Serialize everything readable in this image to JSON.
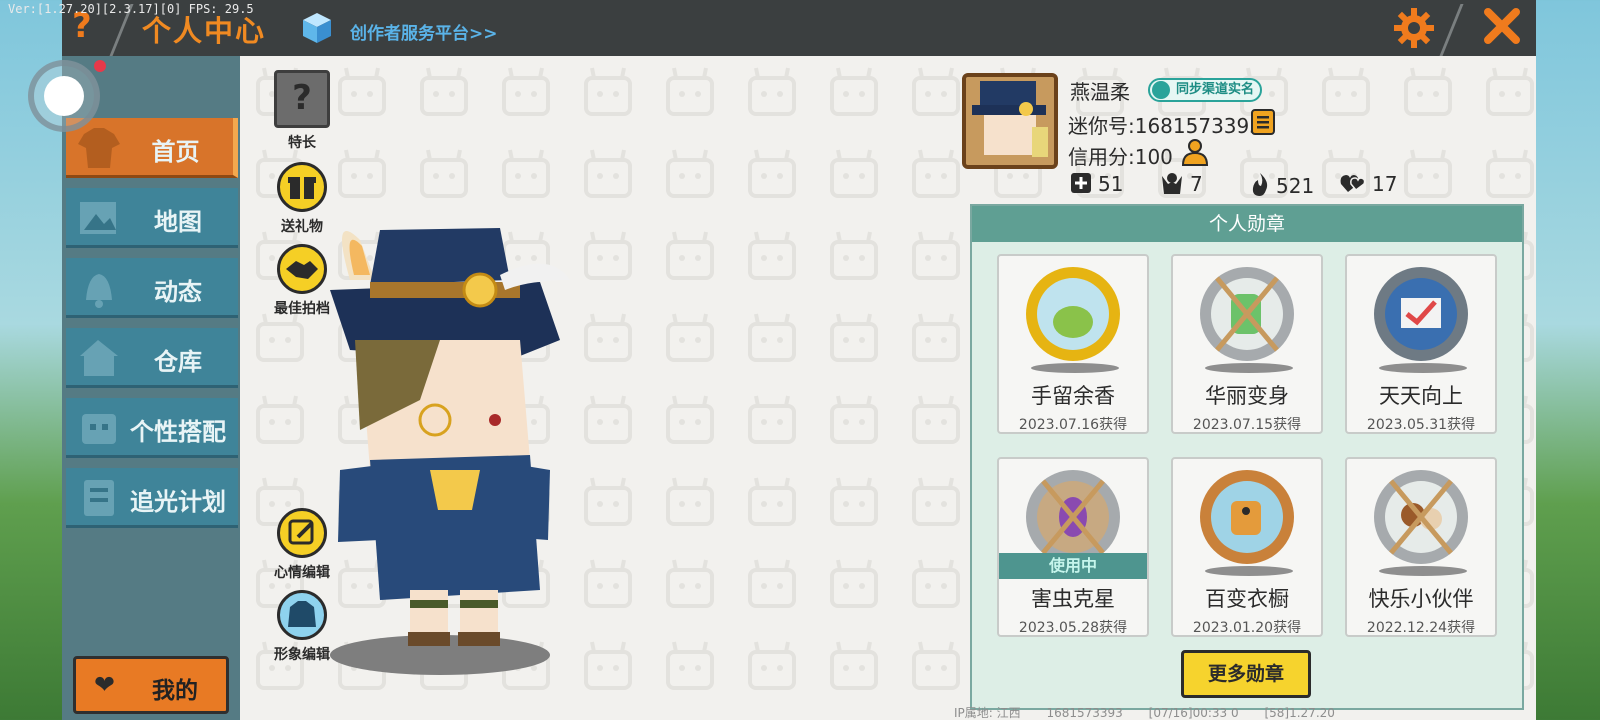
{
  "debug_text": "Ver:[1.27.20][2.3.17][0] FPS: 29.5",
  "header": {
    "help_glyph": "?",
    "title": "个人中心",
    "creator_link": "创作者服务平台>>",
    "settings_icon": "gear-icon",
    "close_icon": "close-icon",
    "accent_color": "#f07b1d"
  },
  "sidebar": {
    "items": [
      {
        "label": "首页",
        "icon": "shirt-icon",
        "active": true
      },
      {
        "label": "地图",
        "icon": "map-icon",
        "active": false
      },
      {
        "label": "动态",
        "icon": "bell-icon",
        "active": false
      },
      {
        "label": "仓库",
        "icon": "house-icon",
        "active": false
      },
      {
        "label": "个性搭配",
        "icon": "outfit-icon",
        "active": false
      },
      {
        "label": "追光计划",
        "icon": "plan-icon",
        "active": false
      }
    ],
    "mine_label": "我的",
    "active_color": "#d8742a"
  },
  "left_actions": {
    "specialty": "特长",
    "gift": "送礼物",
    "best_photo": "最佳拍档",
    "mood_edit": "心情编辑",
    "avatar_edit": "形象编辑"
  },
  "profile": {
    "name": "燕温柔",
    "sync_badge": "同步渠道实名",
    "mini_id": "迷你号:1681573393",
    "credit": "信用分:100",
    "stats": [
      {
        "icon": "add-friend-icon",
        "value": "51"
      },
      {
        "icon": "fans-icon",
        "value": "7"
      },
      {
        "icon": "flame-icon",
        "value": "521"
      },
      {
        "icon": "hearts-icon",
        "value": "17"
      }
    ]
  },
  "medals": {
    "title": "个人勋章",
    "in_use_label": "使用中",
    "items": [
      {
        "name": "手留余香",
        "date": "2023.07.16获得",
        "color": "#e6b412",
        "in_use": false
      },
      {
        "name": "华丽变身",
        "date": "2023.07.15获得",
        "color": "#a6aaad",
        "in_use": false
      },
      {
        "name": "天天向上",
        "date": "2023.05.31获得",
        "color": "#6e7a84",
        "in_use": false
      },
      {
        "name": "害虫克星",
        "date": "2023.05.28获得",
        "color": "#a6aaad",
        "in_use": true
      },
      {
        "name": "百变衣橱",
        "date": "2023.01.20获得",
        "color": "#c9813a",
        "in_use": false
      },
      {
        "name": "快乐小伙伴",
        "date": "2022.12.24获得",
        "color": "#a6aaad",
        "in_use": false
      }
    ],
    "more_label": "更多勋章"
  },
  "footer": {
    "ip": "IP属地: 江西",
    "uid": "1681573393",
    "time": "[07/16]00:33 0",
    "version": "[58]1.27.20"
  }
}
